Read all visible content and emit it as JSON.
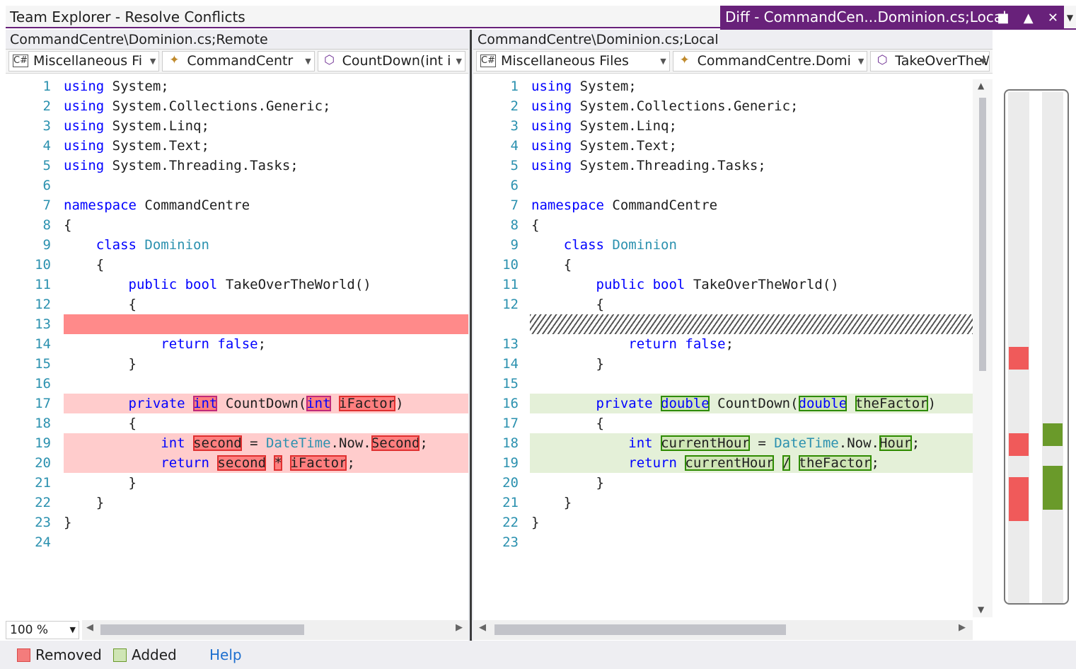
{
  "window": {
    "title": "Team Explorer - Resolve Conflicts",
    "tab": "Diff - CommandCen...Dominion.cs;Local",
    "tab_icons": [
      "pin-icon",
      "keep-open-icon",
      "close-icon"
    ]
  },
  "left": {
    "path": "CommandCentre\\Dominion.cs;Remote",
    "combos": [
      "Miscellaneous Fi",
      "CommandCentr",
      "CountDown(int i"
    ],
    "lines": [
      {
        "n": "1",
        "code": "using System;"
      },
      {
        "n": "2",
        "code": "using System.Collections.Generic;"
      },
      {
        "n": "3",
        "code": "using System.Linq;"
      },
      {
        "n": "4",
        "code": "using System.Text;"
      },
      {
        "n": "5",
        "code": "using System.Threading.Tasks;"
      },
      {
        "n": "6",
        "code": ""
      },
      {
        "n": "7",
        "code": "namespace CommandCentre"
      },
      {
        "n": "8",
        "code": "{"
      },
      {
        "n": "9",
        "code": "    class Dominion"
      },
      {
        "n": "10",
        "code": "    {"
      },
      {
        "n": "11",
        "code": "        public bool TakeOverTheWorld()"
      },
      {
        "n": "12",
        "code": "        {"
      },
      {
        "n": "13",
        "code": ""
      },
      {
        "n": "14",
        "code": "            return false;"
      },
      {
        "n": "15",
        "code": "        }"
      },
      {
        "n": "16",
        "code": ""
      },
      {
        "n": "17",
        "code": "        private int CountDown(int iFactor)"
      },
      {
        "n": "18",
        "code": "        {"
      },
      {
        "n": "19",
        "code": "            int second = DateTime.Now.Second;"
      },
      {
        "n": "20",
        "code": "            return second * iFactor;"
      },
      {
        "n": "21",
        "code": "        }"
      },
      {
        "n": "22",
        "code": "    }"
      },
      {
        "n": "23",
        "code": "}"
      },
      {
        "n": "24",
        "code": ""
      }
    ]
  },
  "right": {
    "path": "CommandCentre\\Dominion.cs;Local",
    "combos": [
      "Miscellaneous Files",
      "CommandCentre.Domi",
      "TakeOverTheWorld()"
    ],
    "lines": [
      {
        "n": "1",
        "code": "using System;"
      },
      {
        "n": "2",
        "code": "using System.Collections.Generic;"
      },
      {
        "n": "3",
        "code": "using System.Linq;"
      },
      {
        "n": "4",
        "code": "using System.Text;"
      },
      {
        "n": "5",
        "code": "using System.Threading.Tasks;"
      },
      {
        "n": "6",
        "code": ""
      },
      {
        "n": "7",
        "code": "namespace CommandCentre"
      },
      {
        "n": "8",
        "code": "{"
      },
      {
        "n": "9",
        "code": "    class Dominion"
      },
      {
        "n": "10",
        "code": "    {"
      },
      {
        "n": "11",
        "code": "        public bool TakeOverTheWorld()"
      },
      {
        "n": "12",
        "code": "        {"
      },
      {
        "n": "",
        "code": ""
      },
      {
        "n": "13",
        "code": "            return false;"
      },
      {
        "n": "14",
        "code": "        }"
      },
      {
        "n": "15",
        "code": ""
      },
      {
        "n": "16",
        "code": "        private double CountDown(double theFactor)"
      },
      {
        "n": "17",
        "code": "        {"
      },
      {
        "n": "18",
        "code": "            int currentHour = DateTime.Now.Hour;"
      },
      {
        "n": "19",
        "code": "            return currentHour / theFactor;"
      },
      {
        "n": "20",
        "code": "        }"
      },
      {
        "n": "21",
        "code": "    }"
      },
      {
        "n": "22",
        "code": "}"
      },
      {
        "n": "23",
        "code": ""
      }
    ]
  },
  "zoom": "100 %",
  "legend": {
    "removed": "Removed",
    "added": "Added",
    "help": "Help"
  },
  "colors": {
    "accent": "#68217a",
    "removed": "#ff7f7f",
    "added": "#cfe5b5",
    "line_number": "#2b91af",
    "keyword": "#0000ff",
    "type": "#2b91af"
  }
}
